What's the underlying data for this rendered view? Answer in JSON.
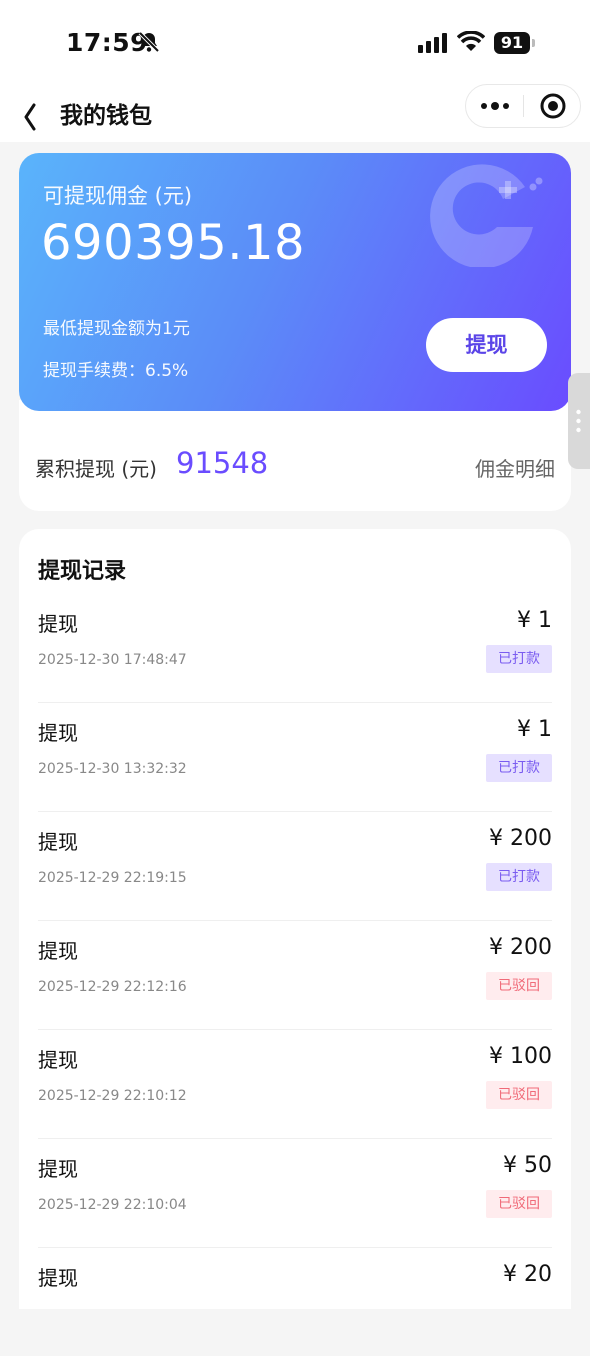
{
  "status_bar": {
    "time": "17:59",
    "battery": "91"
  },
  "navbar": {
    "title": "我的钱包"
  },
  "balance": {
    "label": "可提现佣金 (元)",
    "amount": "690395.18",
    "min_note": "最低提现金额为1元",
    "fee_note": "提现手续费：6.5%",
    "withdraw_label": "提现"
  },
  "total": {
    "label": "累积提现 (元)",
    "value": "91548",
    "detail_link": "佣金明细"
  },
  "records": {
    "title": "提现记录",
    "items": [
      {
        "name": "提现",
        "time": "2025-12-30 17:48:47",
        "amount": "¥ 1",
        "status": "已打款",
        "status_type": "paid"
      },
      {
        "name": "提现",
        "time": "2025-12-30 13:32:32",
        "amount": "¥ 1",
        "status": "已打款",
        "status_type": "paid"
      },
      {
        "name": "提现",
        "time": "2025-12-29 22:19:15",
        "amount": "¥ 200",
        "status": "已打款",
        "status_type": "paid"
      },
      {
        "name": "提现",
        "time": "2025-12-29 22:12:16",
        "amount": "¥ 200",
        "status": "已驳回",
        "status_type": "reject"
      },
      {
        "name": "提现",
        "time": "2025-12-29 22:10:12",
        "amount": "¥ 100",
        "status": "已驳回",
        "status_type": "reject"
      },
      {
        "name": "提现",
        "time": "2025-12-29 22:10:04",
        "amount": "¥ 50",
        "status": "已驳回",
        "status_type": "reject"
      },
      {
        "name": "提现",
        "time": "",
        "amount": "¥ 20",
        "status": "",
        "status_type": ""
      }
    ]
  },
  "colors": {
    "accent": "#6a4cff",
    "paid_bg": "#e6e0ff",
    "reject_bg": "#ffecee"
  }
}
